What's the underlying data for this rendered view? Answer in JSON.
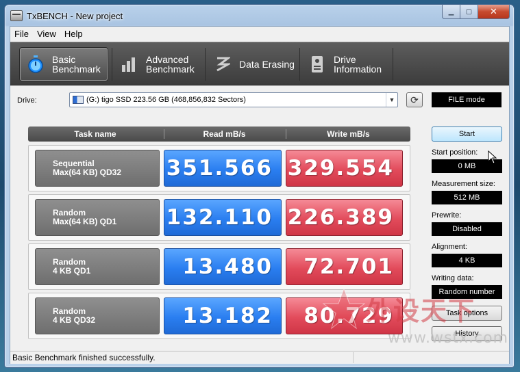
{
  "window": {
    "title": "TxBENCH - New project"
  },
  "menu": [
    "File",
    "View",
    "Help"
  ],
  "toolbar": {
    "tabs": [
      {
        "label": "Basic\nBenchmark",
        "icon": "stopwatch-icon",
        "active": true
      },
      {
        "label": "Advanced\nBenchmark",
        "icon": "bar-chart-icon",
        "active": false
      },
      {
        "label": "Data Erasing",
        "icon": "eraser-icon",
        "active": false
      },
      {
        "label": "Drive\nInformation",
        "icon": "drive-info-icon",
        "active": false
      }
    ]
  },
  "drive": {
    "label": "Drive:",
    "selected": "(G:) tigo SSD  223.56 GB (468,856,832 Sectors)",
    "mode": "FILE mode"
  },
  "results": {
    "headers": {
      "task": "Task name",
      "read": "Read mB/s",
      "write": "Write mB/s"
    },
    "rows": [
      {
        "task_line1": "Sequential",
        "task_line2": "Max(64 KB) QD32",
        "read": "351.566",
        "write": "329.554"
      },
      {
        "task_line1": "Random",
        "task_line2": "Max(64 KB) QD1",
        "read": "132.110",
        "write": "226.389"
      },
      {
        "task_line1": "Random",
        "task_line2": "4 KB QD1",
        "read": "13.480",
        "write": "72.701"
      },
      {
        "task_line1": "Random",
        "task_line2": "4 KB QD32",
        "read": "13.182",
        "write": "80.729"
      }
    ]
  },
  "side": {
    "start": "Start",
    "start_position_label": "Start position:",
    "start_position": "0 MB",
    "measurement_size_label": "Measurement size:",
    "measurement_size": "512 MB",
    "prewrite_label": "Prewrite:",
    "prewrite": "Disabled",
    "alignment_label": "Alignment:",
    "alignment": "4 KB",
    "writing_data_label": "Writing data:",
    "writing_data": "Random number",
    "task_options": "Task options",
    "history": "History"
  },
  "status": {
    "text": "Basic Benchmark finished successfully."
  },
  "watermark": {
    "main": "外设天下",
    "url": "www.wstx.com"
  },
  "colors": {
    "read": "#2a7ef0",
    "write": "#e24b5b",
    "toolbar": "#4a4a4a"
  }
}
